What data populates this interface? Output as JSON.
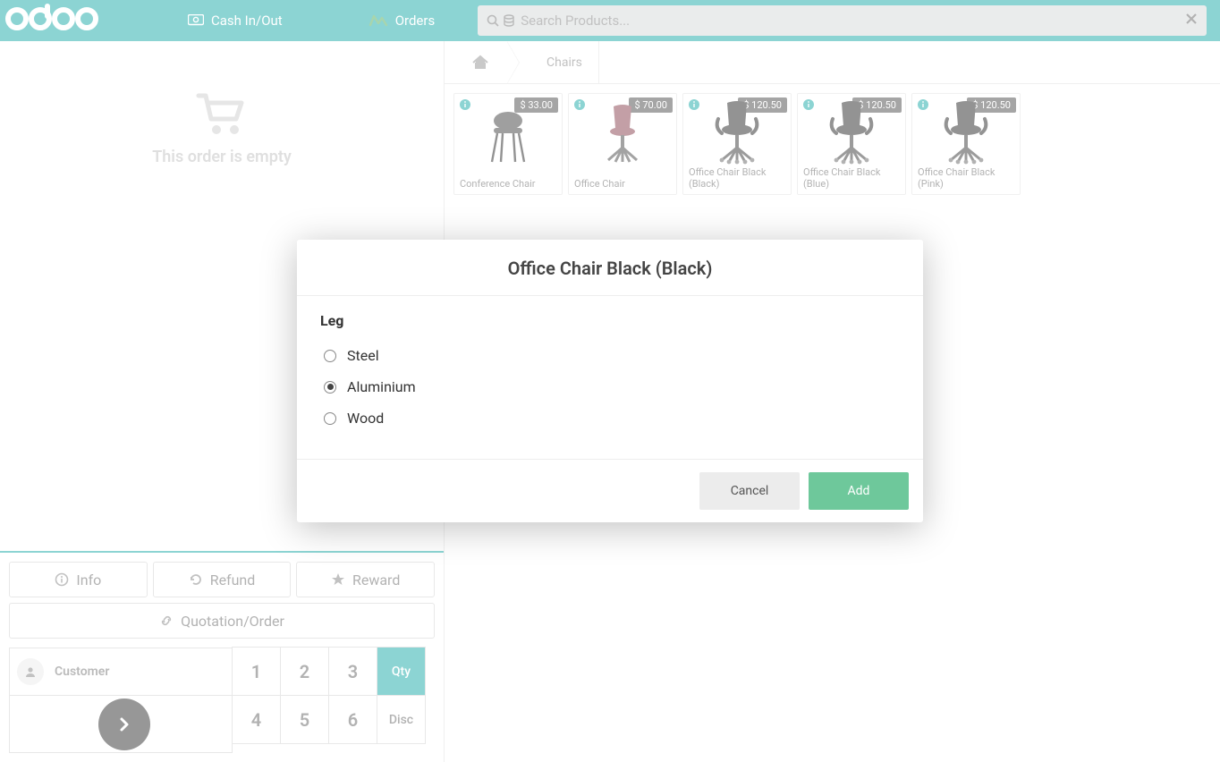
{
  "header": {
    "logo_text": "odoo",
    "cash_label": "Cash In/Out",
    "orders_label": "Orders",
    "search_placeholder": "Search Products..."
  },
  "cart": {
    "empty_text": "This order is empty"
  },
  "order_actions": {
    "info": "Info",
    "refund": "Refund",
    "reward": "Reward",
    "quotation": "Quotation/Order"
  },
  "customer": {
    "label": "Customer"
  },
  "numpad": {
    "k1": "1",
    "k2": "2",
    "k3": "3",
    "qty": "Qty",
    "k4": "4",
    "k5": "5",
    "k6": "6",
    "disc": "Disc"
  },
  "breadcrumb": {
    "current": "Chairs"
  },
  "products": [
    {
      "name": "Conference Chair",
      "price": "$ 33.00",
      "kind": "conf"
    },
    {
      "name": "Office Chair",
      "price": "$ 70.00",
      "kind": "swivel-red"
    },
    {
      "name": "Office Chair Black (Black)",
      "price": "$ 120.50",
      "kind": "exec"
    },
    {
      "name": "Office Chair Black (Blue)",
      "price": "$ 120.50",
      "kind": "exec"
    },
    {
      "name": "Office Chair Black (Pink)",
      "price": "$ 120.50",
      "kind": "exec"
    }
  ],
  "modal": {
    "title": "Office Chair Black (Black)",
    "attribute_label": "Leg",
    "options": [
      {
        "label": "Steel",
        "selected": false
      },
      {
        "label": "Aluminium",
        "selected": true
      },
      {
        "label": "Wood",
        "selected": false
      }
    ],
    "cancel": "Cancel",
    "add": "Add"
  }
}
